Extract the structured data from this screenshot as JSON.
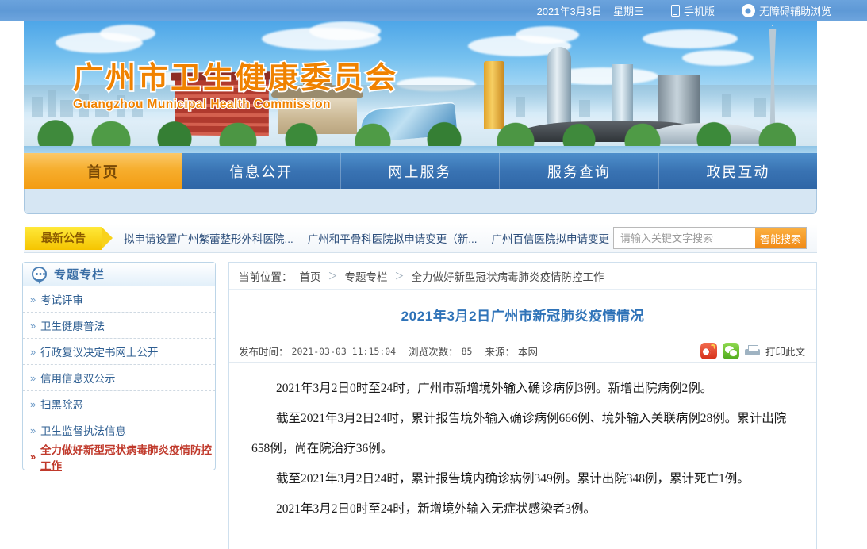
{
  "topbar": {
    "date": "2021年3月3日",
    "weekday": "星期三",
    "mobile_label": "手机版",
    "accessibility_label": "无障碍辅助浏览"
  },
  "banner": {
    "title_cn": "广州市卫生健康委员会",
    "title_en": "Guangzhou Municipal Health Commission"
  },
  "nav": {
    "items": [
      {
        "label": "首页",
        "active": true
      },
      {
        "label": "信息公开",
        "active": false
      },
      {
        "label": "网上服务",
        "active": false
      },
      {
        "label": "服务查询",
        "active": false
      },
      {
        "label": "政民互动",
        "active": false
      }
    ]
  },
  "notice": {
    "tag": "最新公告",
    "links": [
      "拟申请设置广州紫蕾整形外科医院...",
      "广州和平骨科医院拟申请变更（新...",
      "广州百信医院拟申请变更（新"
    ]
  },
  "search": {
    "placeholder": "请输入关键文字搜索",
    "value": "",
    "button_label": "智能搜索"
  },
  "sidebar": {
    "title": "专题专栏",
    "items": [
      {
        "label": "考试评审"
      },
      {
        "label": "卫生健康普法"
      },
      {
        "label": "行政复议决定书网上公开"
      },
      {
        "label": "信用信息双公示"
      },
      {
        "label": "扫黑除恶"
      },
      {
        "label": "卫生监督执法信息"
      },
      {
        "label": "全力做好新型冠状病毒肺炎疫情防控工作"
      }
    ]
  },
  "breadcrumb": {
    "label": "当前位置：",
    "items": [
      "首页",
      "专题专栏",
      "全力做好新型冠状病毒肺炎疫情防控工作"
    ],
    "separator": "＞"
  },
  "article": {
    "title": "2021年3月2日广州市新冠肺炎疫情情况",
    "meta": {
      "publish_label": "发布时间：",
      "publish_time": "2021-03-03 11:15:04",
      "views_label": "浏览次数：",
      "views": "85",
      "source_label": "来源：",
      "source": "本网",
      "print_label": "打印此文"
    },
    "paragraphs": [
      "2021年3月2日0时至24时，广州市新增境外输入确诊病例3例。新增出院病例2例。",
      "截至2021年3月2日24时，累计报告境外输入确诊病例666例、境外输入关联病例28例。累计出院658例，尚在院治疗36例。",
      "截至2021年3月2日24时，累计报告境内确诊病例349例。累计出院348例，累计死亡1例。",
      "2021年3月2日0时至24时，新增境外输入无症状感染者3例。"
    ]
  },
  "colors": {
    "accent_orange": "#F08200",
    "nav_blue": "#3973b3",
    "topbar_blue": "#5e99d6",
    "title_blue": "#2f73b8",
    "active_red": "#c0392b",
    "notice_yellow": "#f8d21b"
  }
}
